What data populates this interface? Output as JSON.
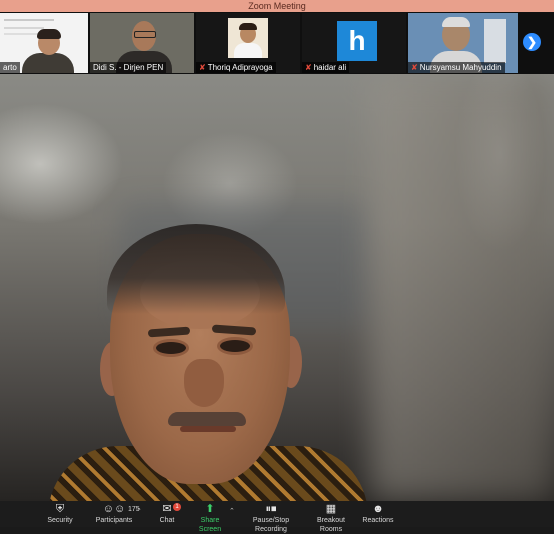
{
  "window": {
    "title": "Zoom Meeting"
  },
  "participants_strip": [
    {
      "name": "arto",
      "muted": false
    },
    {
      "name": "Didi S. - Dirjen PEN",
      "muted": false
    },
    {
      "name": "Thoriq Adiprayoga",
      "muted": true
    },
    {
      "name": "haidar ali",
      "muted": true,
      "avatar_letter": "h",
      "avatar_color": "#1e88d8"
    },
    {
      "name": "Nursyamsu Mahyuddin",
      "muted": true
    }
  ],
  "strip_next_icon": "chevron-right",
  "toolbar": {
    "security": "Security",
    "participants": "Participants",
    "participants_count": "175",
    "chat": "Chat",
    "chat_badge": "1",
    "share_screen": "Share Screen",
    "record": "Pause/Stop Recording",
    "breakout": "Breakout Rooms",
    "reactions": "Reactions"
  },
  "colors": {
    "accent": "#2d8cff",
    "share_green": "#3ccf6a",
    "title_bar": "#e8a08c",
    "mic_muted": "#e24a3b"
  }
}
